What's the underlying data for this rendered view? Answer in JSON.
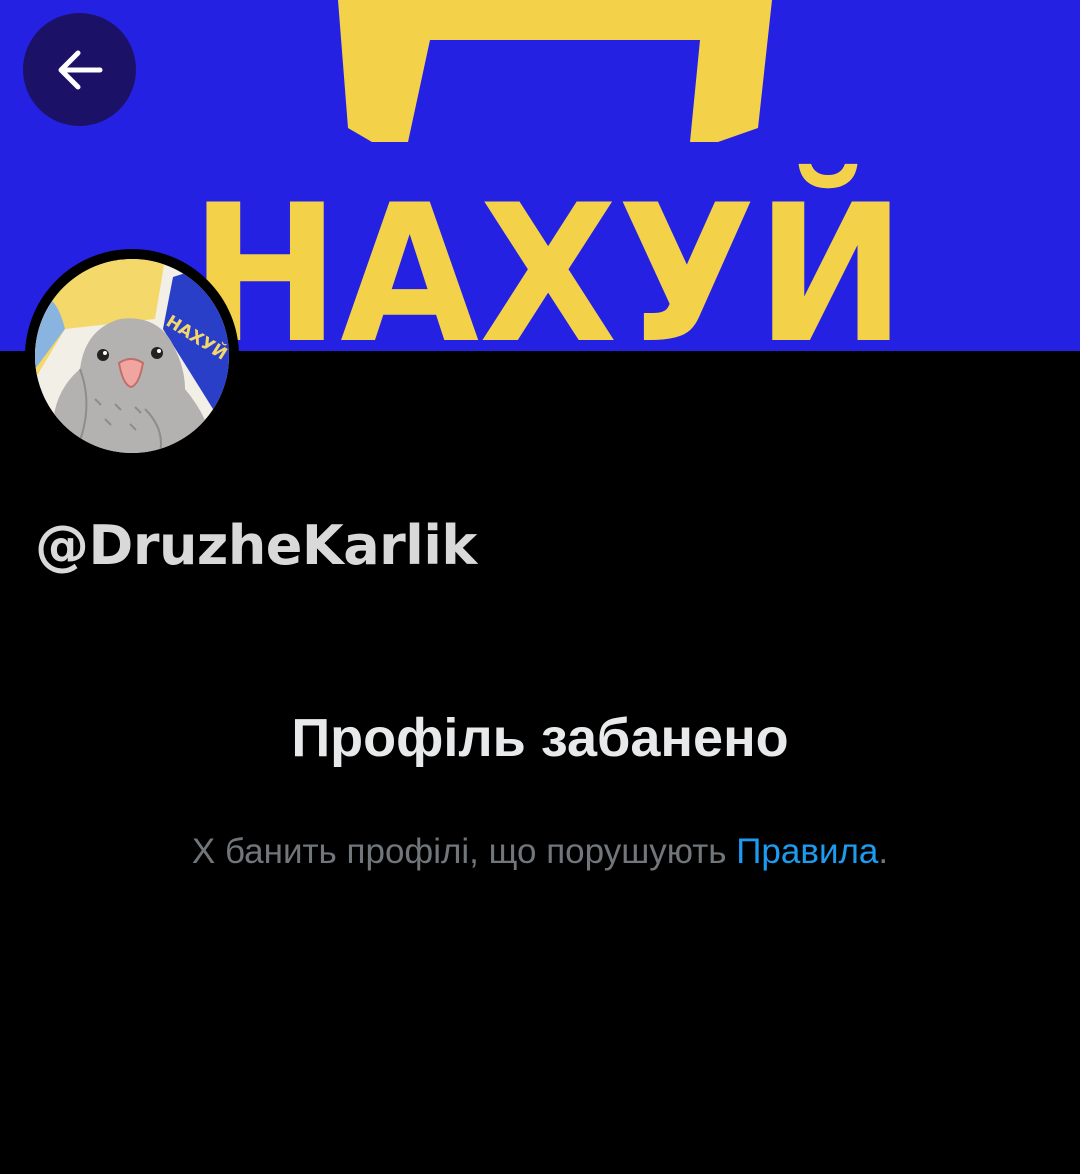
{
  "banner": {
    "text": "НАХУЙ",
    "background": "#2422e6",
    "text_color": "#f5d548"
  },
  "back_button": {
    "icon": "arrow-left-icon",
    "background": "#1b1267"
  },
  "avatar": {
    "badge_text": "НАХУЙ"
  },
  "profile": {
    "handle": "@DruzheKarlik"
  },
  "ban_notice": {
    "title": "Профіль забанено",
    "description_prefix": "X банить профілі, що порушують ",
    "link_text": "Правила",
    "description_suffix": ".",
    "link_color": "#1d9bf0"
  }
}
